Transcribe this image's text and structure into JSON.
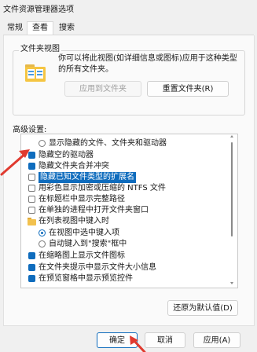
{
  "window": {
    "title": "文件资源管理器选项"
  },
  "tabs": [
    {
      "label": "常规",
      "active": false
    },
    {
      "label": "查看",
      "active": true
    },
    {
      "label": "搜索",
      "active": false
    }
  ],
  "folder_views": {
    "group_label": "文件夹视图",
    "description": "你可以将此视图(如详细信息或图标)应用于这种类型的所有文件夹。",
    "apply_button": "应用到文件夹",
    "reset_button": "重置文件夹(R)"
  },
  "advanced": {
    "label": "高级设置:",
    "items": [
      {
        "text": "显示隐藏的文件、文件夹和驱动器",
        "kind": "radio",
        "checked": false,
        "indent": 1
      },
      {
        "text": "隐藏空的驱动器",
        "kind": "checkbox",
        "checked": true,
        "indent": 0
      },
      {
        "text": "隐藏文件夹合并冲突",
        "kind": "checkbox",
        "checked": true,
        "indent": 0
      },
      {
        "text": "隐藏已知文件类型的扩展名",
        "kind": "checkbox",
        "checked": false,
        "indent": 0,
        "selected": true
      },
      {
        "text": "用彩色显示加密或压缩的 NTFS 文件",
        "kind": "checkbox",
        "checked": false,
        "indent": 0
      },
      {
        "text": "在标题栏中显示完整路径",
        "kind": "checkbox",
        "checked": false,
        "indent": 0
      },
      {
        "text": "在单独的进程中打开文件夹窗口",
        "kind": "checkbox",
        "checked": false,
        "indent": 0
      },
      {
        "text": "在列表视图中键入时",
        "kind": "folder",
        "checked": false,
        "indent": 0
      },
      {
        "text": "在视图中选中键入项",
        "kind": "radio",
        "checked": true,
        "indent": 1
      },
      {
        "text": "自动键入到\"搜索\"框中",
        "kind": "radio",
        "checked": false,
        "indent": 1
      },
      {
        "text": "在缩略图上显示文件图标",
        "kind": "checkbox",
        "checked": true,
        "indent": 0
      },
      {
        "text": "在文件夹提示中显示文件大小信息",
        "kind": "checkbox",
        "checked": true,
        "indent": 0
      },
      {
        "text": "在预览窗格中显示预览控件",
        "kind": "checkbox",
        "checked": true,
        "indent": 0
      }
    ],
    "restore_button": "还原为默认值(D)"
  },
  "footer": {
    "ok": "确定",
    "cancel": "取消",
    "apply": "应用(A)"
  },
  "colors": {
    "accent": "#0f6cbd",
    "annotation": "#e03a2f"
  }
}
